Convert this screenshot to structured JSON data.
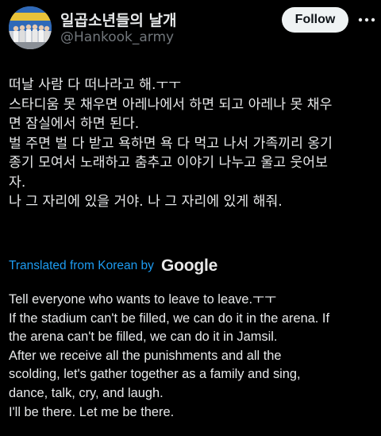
{
  "author": {
    "display_name": "일곱소년들의 날개",
    "handle": "@Hankook_army",
    "avatar_icon": "profile-photo-group"
  },
  "actions": {
    "follow_label": "Follow",
    "more_icon": "more-horizontal-icon"
  },
  "tweet": {
    "lines": [
      "떠날 사람 다 떠나라고 해.ㅜㅜ",
      "스타디움 못 채우면 아레나에서 하면 되고 아레나 못 채우",
      "면 잠실에서 하면 된다.",
      "벌 주면 벌 다 받고 욕하면 욕 다 먹고 나서 가족끼리 옹기",
      "종기 모여서 노래하고 춤추고 이야기 나누고 울고 웃어보",
      "자.",
      "나 그 자리에 있을 거야. 나 그 자리에 있게 해줘."
    ]
  },
  "translation": {
    "label": "Translated from Korean by",
    "provider": "Google",
    "lines": [
      "Tell everyone who wants to leave to leave.ㅜㅜ",
      "If the stadium can't be filled, we can do it in the arena. If",
      "the arena can't be filled, we can do it in Jamsil.",
      "After we receive all the punishments and all the",
      "scolding, let's gather together as a family and sing,",
      "dance, talk, cry, and laugh.",
      "I'll be there. Let me be there."
    ]
  },
  "colors": {
    "background": "#000000",
    "text_primary": "#e7e9ea",
    "text_secondary": "#71767b",
    "link": "#1d9bf0",
    "follow_bg": "#eff3f4",
    "follow_text": "#0f1419"
  }
}
